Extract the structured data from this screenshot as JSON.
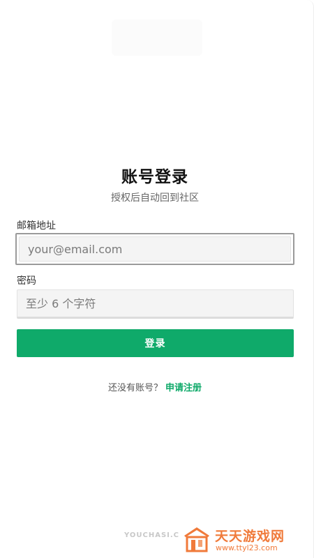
{
  "header": {
    "title": "账号登录",
    "subtitle": "授权后自动回到社区"
  },
  "form": {
    "email": {
      "label": "邮箱地址",
      "placeholder": "your@email.com",
      "value": ""
    },
    "password": {
      "label": "密码",
      "placeholder": "至少 6 个字符",
      "value": ""
    },
    "submit_label": "登录"
  },
  "register": {
    "prompt": "还没有账号？",
    "link_label": "申请注册"
  },
  "footer": {
    "brand": "YOUCHASI.C"
  },
  "watermark": {
    "name": "天天游戏网",
    "url": "www.ttyl23.com"
  },
  "colors": {
    "accent": "#0faa6a",
    "watermark": "#f07a3a"
  },
  "icons": {
    "watermark_logo": "house-logo-icon"
  }
}
